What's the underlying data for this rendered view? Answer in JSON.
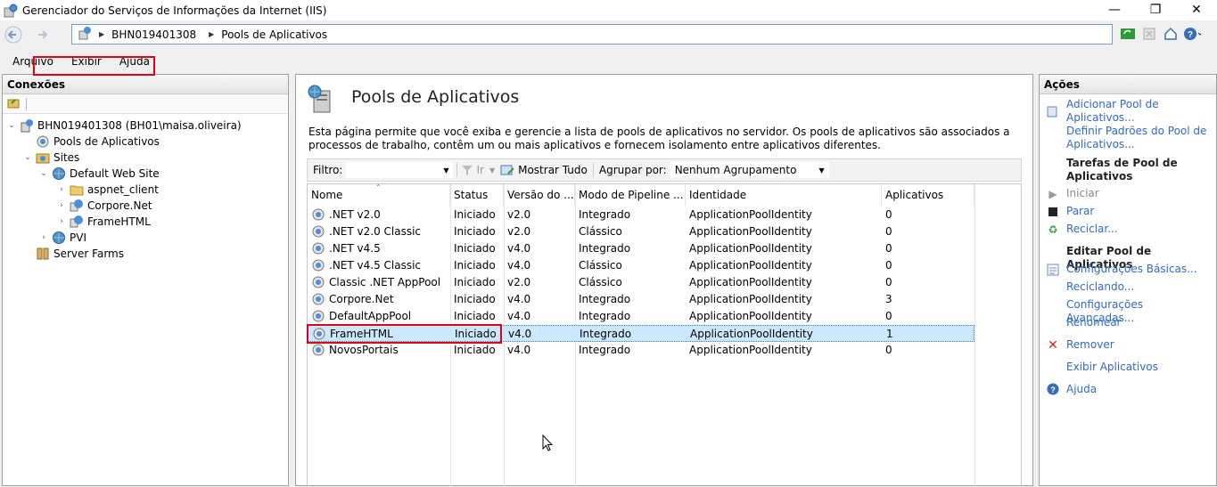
{
  "window": {
    "title": "Gerenciador do Serviços de Informações da Internet (IIS)",
    "controls": [
      "—",
      "❐",
      "✕"
    ]
  },
  "address": {
    "crumbs": [
      "BHN019401308",
      "Pools de Aplicativos"
    ]
  },
  "menu": {
    "items": [
      "Arquivo",
      "Exibir",
      "Ajuda"
    ]
  },
  "connections": {
    "header": "Conexões",
    "tree": [
      {
        "label": "BHN019401308 (BH01\\maisa.oliveira)",
        "icon": "server-icon"
      },
      {
        "label": "Pools de Aplicativos",
        "icon": "app-pool-icon"
      },
      {
        "label": "Sites",
        "icon": "sites-folder-icon"
      },
      {
        "label": "Default Web Site",
        "icon": "globe-icon"
      },
      {
        "label": "aspnet_client",
        "icon": "folder-icon"
      },
      {
        "label": "Corpore.Net",
        "icon": "web-app-icon"
      },
      {
        "label": "FrameHTML",
        "icon": "web-app-icon"
      },
      {
        "label": "PVI",
        "icon": "globe-icon"
      },
      {
        "label": "Server Farms",
        "icon": "server-farm-icon"
      }
    ]
  },
  "main": {
    "title": "Pools de Aplicativos",
    "description": "Esta página permite que você exiba e gerencie a lista de pools de aplicativos no servidor. Os pools de aplicativos são associados a processos de trabalho, contêm um ou mais aplicativos e fornecem isolamento entre aplicativos diferentes.",
    "filter": {
      "label": "Filtro:",
      "value": "",
      "go_label": "Ir",
      "show_all_label": "Mostrar Tudo",
      "group_label": "Agrupar por:",
      "group_value": "Nenhum Agrupamento"
    },
    "columns": [
      "Nome",
      "Status",
      "Versão do ...",
      "Modo de Pipeline ...",
      "Identidade",
      "Aplicativos"
    ],
    "rows": [
      [
        ".NET v2.0",
        "Iniciado",
        "v2.0",
        "Integrado",
        "ApplicationPoolIdentity",
        "0"
      ],
      [
        ".NET v2.0 Classic",
        "Iniciado",
        "v2.0",
        "Clássico",
        "ApplicationPoolIdentity",
        "0"
      ],
      [
        ".NET v4.5",
        "Iniciado",
        "v4.0",
        "Integrado",
        "ApplicationPoolIdentity",
        "0"
      ],
      [
        ".NET v4.5 Classic",
        "Iniciado",
        "v4.0",
        "Clássico",
        "ApplicationPoolIdentity",
        "0"
      ],
      [
        "Classic .NET AppPool",
        "Iniciado",
        "v2.0",
        "Clássico",
        "ApplicationPoolIdentity",
        "0"
      ],
      [
        "Corpore.Net",
        "Iniciado",
        "v4.0",
        "Integrado",
        "ApplicationPoolIdentity",
        "3"
      ],
      [
        "DefaultAppPool",
        "Iniciado",
        "v4.0",
        "Integrado",
        "ApplicationPoolIdentity",
        "0"
      ],
      [
        "FrameHTML",
        "Iniciado",
        "v4.0",
        "Integrado",
        "ApplicationPoolIdentity",
        "1"
      ],
      [
        "NovosPortais",
        "Iniciado",
        "v4.0",
        "Integrado",
        "ApplicationPoolIdentity",
        "0"
      ]
    ],
    "selected_row": "FrameHTML"
  },
  "actions": {
    "header": "Ações",
    "add_pool": "Adicionar Pool de Aplicativos...",
    "set_defaults": "Definir Padrões do Pool de Aplicativos...",
    "tasks_header": "Tarefas de Pool de Aplicativos",
    "start": "Iniciar",
    "stop": "Parar",
    "recycle": "Reciclar...",
    "edit_header": "Editar Pool de Aplicativos",
    "basic_settings": "Configurações Básicas...",
    "recycling": "Reciclando...",
    "advanced_settings": "Configurações Avançadas...",
    "rename": "Renomear",
    "remove": "Remover",
    "view_apps": "Exibir Aplicativos",
    "help": "Ajuda"
  },
  "colors": {
    "highlight": "#e0001a",
    "link": "#3169c6",
    "selection": "#cce8ff"
  }
}
